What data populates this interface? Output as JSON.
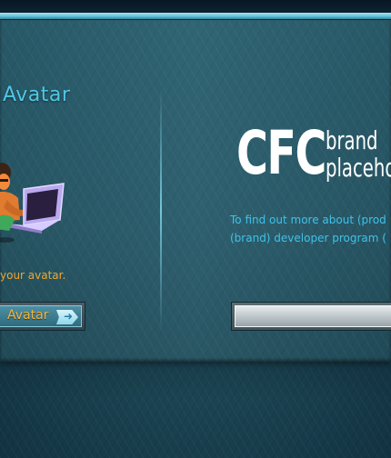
{
  "avatar": {
    "title": "Avatar",
    "description": "your avatar.",
    "button_label": "Avatar",
    "button_arrow": "arrow-right-icon"
  },
  "brand": {
    "logo_main": "CFC",
    "logo_line1": "brand",
    "logo_line2": "placeho",
    "description_line1": "To find out more about (prod",
    "description_line2": "(brand) developer program (",
    "input_value": ""
  },
  "colors": {
    "accent": "#4fc7e6",
    "highlight": "#f0a62e",
    "top_bar": "#67c3d8",
    "panel": "#2a5b6a"
  }
}
